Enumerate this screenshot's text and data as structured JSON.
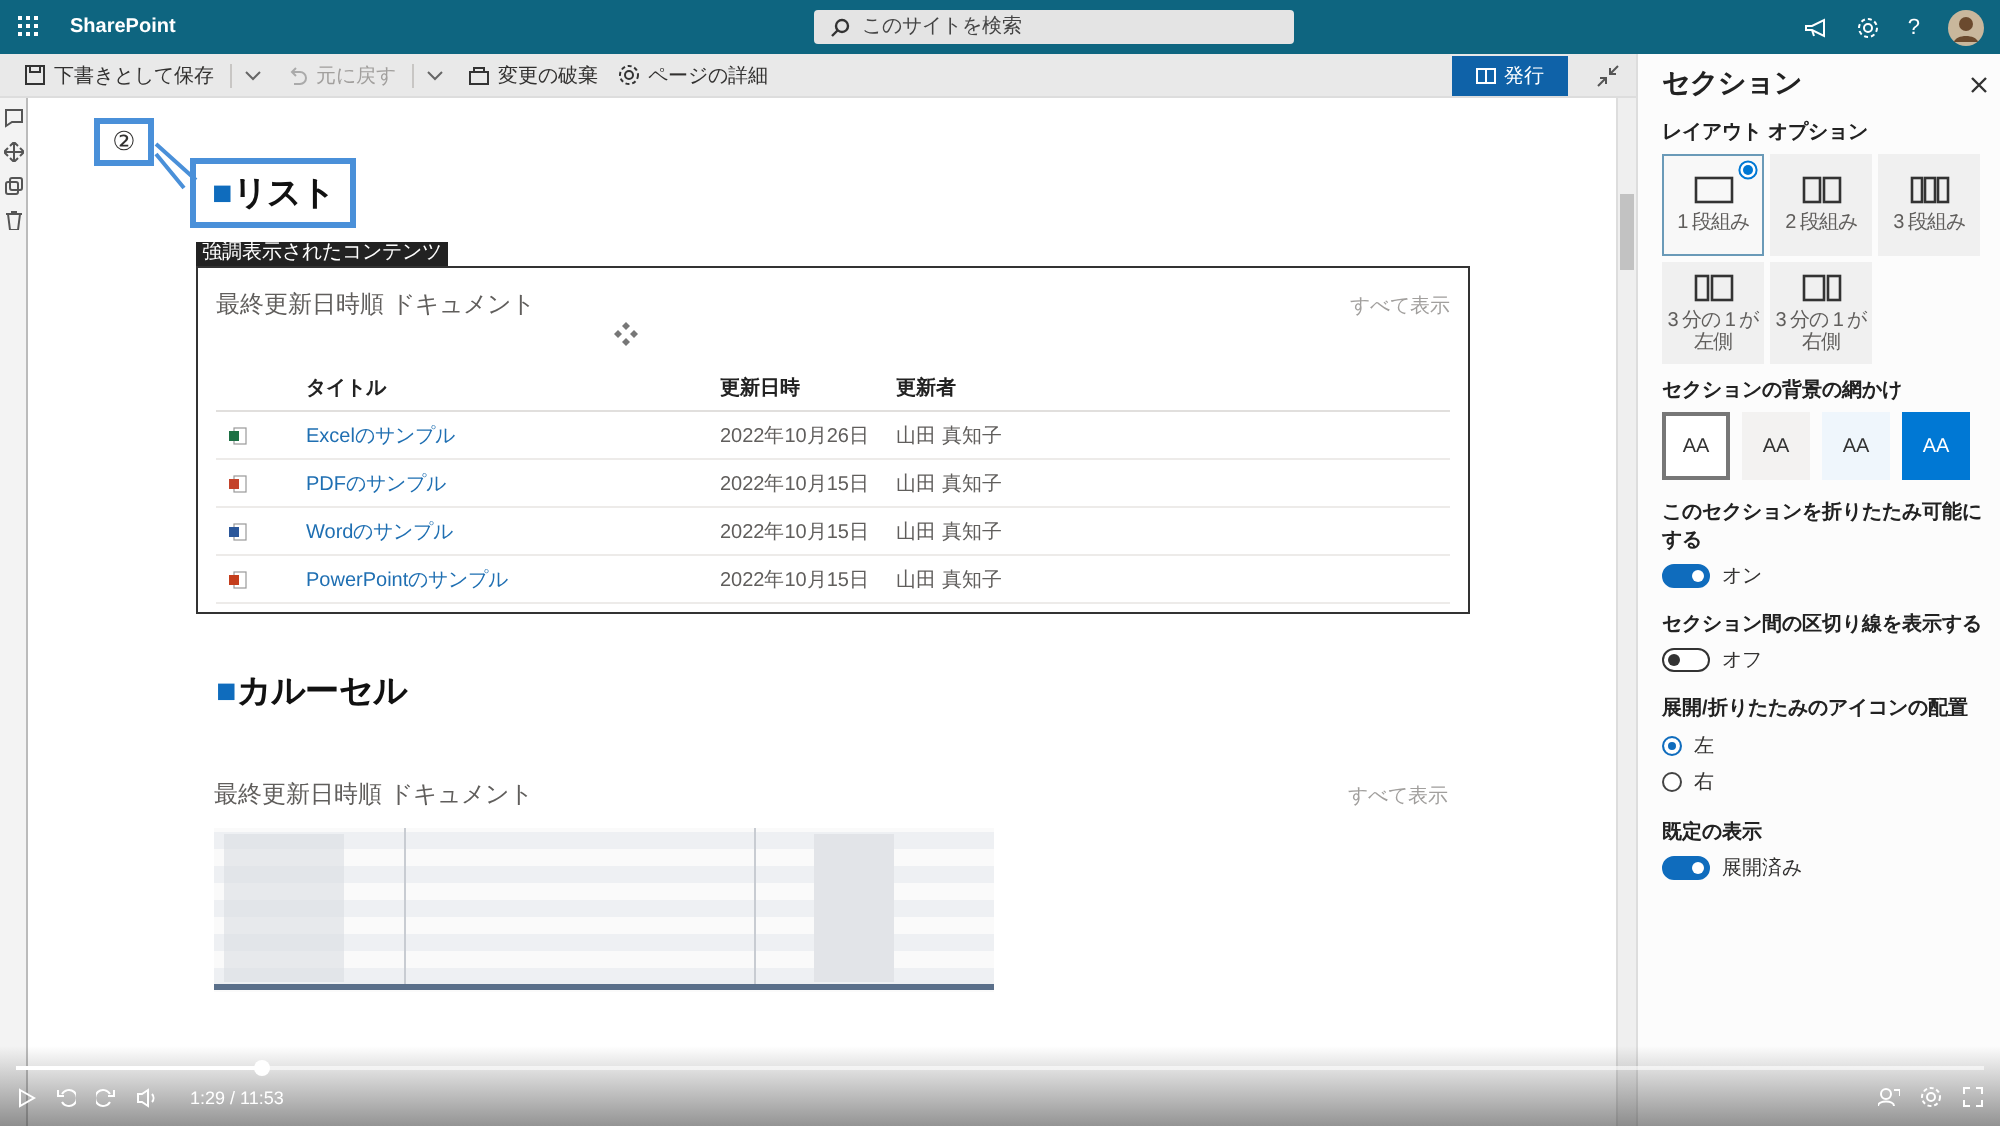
{
  "app": {
    "name": "SharePoint",
    "help": "?"
  },
  "search": {
    "placeholder": "このサイトを検索"
  },
  "command_bar": {
    "items": [
      {
        "kind": "save",
        "label": "下書きとして保存",
        "disabled": false,
        "split": true
      },
      {
        "kind": "undo",
        "label": "元に戻す",
        "disabled": true,
        "split": true
      },
      {
        "kind": "discard",
        "label": "変更の破棄",
        "disabled": false,
        "split": false
      },
      {
        "kind": "details",
        "label": "ページの詳細",
        "disabled": false,
        "split": false
      }
    ],
    "publish": "発行"
  },
  "annotation": {
    "number": "②"
  },
  "list_section": {
    "marker": "■",
    "title": "リスト",
    "tag": "強調表示されたコンテンツ",
    "webpart": {
      "title": "最終更新日時順 ドキュメント",
      "see_all": "すべて表示",
      "columns": [
        "タイトル",
        "更新日時",
        "更新者"
      ],
      "rows": [
        {
          "kind": "excel",
          "title": "Excelのサンプル",
          "modified": "2022年10月26日",
          "author": "山田 真知子"
        },
        {
          "kind": "pdf",
          "title": "PDFのサンプル",
          "modified": "2022年10月15日",
          "author": "山田 真知子"
        },
        {
          "kind": "word",
          "title": "Wordのサンプル",
          "modified": "2022年10月15日",
          "author": "山田 真知子"
        },
        {
          "kind": "powerpoint",
          "title": "PowerPointのサンプル",
          "modified": "2022年10月15日",
          "author": "山田 真知子"
        }
      ]
    }
  },
  "carousel_section": {
    "marker": "■",
    "title": "カルーセル",
    "webpart": {
      "title": "最終更新日時順 ドキュメント",
      "see_all": "すべて表示"
    }
  },
  "panel": {
    "title": "セクション",
    "layout": {
      "label": "レイアウト オプション",
      "options": [
        {
          "kind": "one",
          "label": "1 段組み",
          "selected": true
        },
        {
          "kind": "two",
          "label": "2 段組み",
          "selected": false
        },
        {
          "kind": "three",
          "label": "3 段組み",
          "selected": false
        },
        {
          "kind": "left_third",
          "label": "3 分の 1 が左側",
          "selected": false
        },
        {
          "kind": "right_third",
          "label": "3 分の 1 が右側",
          "selected": false
        }
      ]
    },
    "shading": {
      "label": "セクションの背景の網かけ",
      "options": [
        {
          "label": "AA",
          "color": "#ffffff",
          "selected": true
        },
        {
          "label": "AA",
          "color": "#f3f2f1",
          "selected": false
        },
        {
          "label": "AA",
          "color": "#eff6fc",
          "selected": false
        },
        {
          "label": "AA",
          "color": "#0078d4",
          "selected": false
        }
      ]
    },
    "settings": [
      {
        "kind": "toggle",
        "label": "このセクションを折りたたみ可能にする",
        "on": true,
        "state": "オン"
      },
      {
        "kind": "toggle",
        "label": "セクション間の区切り線を表示する",
        "on": false,
        "state": "オフ"
      },
      {
        "kind": "radio",
        "label": "展開/折りたたみのアイコンの配置",
        "options": [
          {
            "label": "左",
            "selected": true
          },
          {
            "label": "右",
            "selected": false
          }
        ]
      },
      {
        "kind": "toggle",
        "label": "既定の表示",
        "on": true,
        "state": "展開済み"
      }
    ]
  },
  "player": {
    "time": "1:29 / 11:53",
    "level": 0.125
  }
}
